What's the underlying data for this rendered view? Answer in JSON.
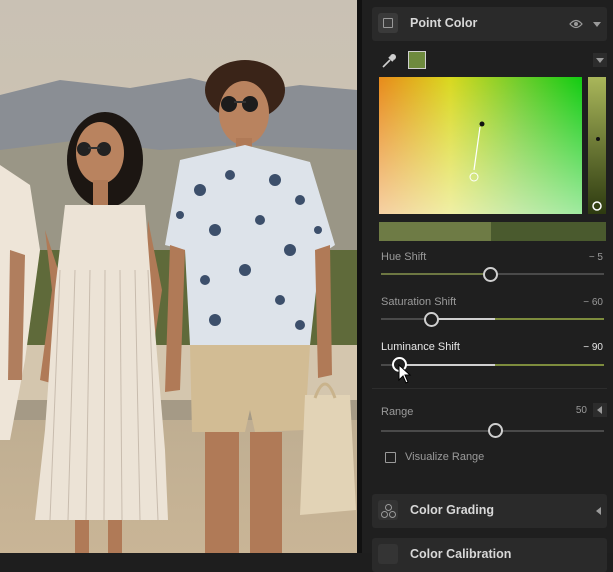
{
  "colors": {
    "panel_bg": "#1f1f1f",
    "header_bg": "#2a2a2a",
    "accent": "#7d8c3d",
    "swatch": "#6e8a3e"
  },
  "point_color": {
    "title": "Point Color",
    "section_icon": "point-color-icon",
    "visibility_icon": "eye-icon",
    "picker_icon": "eyedropper-icon",
    "sliders": [
      {
        "label": "Hue Shift",
        "value": "− 5",
        "level": 0.5,
        "active": false
      },
      {
        "label": "Saturation Shift",
        "value": "− 60",
        "level": 0.2,
        "active": false
      },
      {
        "label": "Luminance Shift",
        "value": "− 90",
        "level": 0.05,
        "active": true
      }
    ],
    "range": {
      "label": "Range",
      "value": "50",
      "level": 0.5
    },
    "visualize": {
      "label": "Visualize Range",
      "checked": false
    }
  },
  "color_grading": {
    "title": "Color Grading",
    "icon": "color-grading-icon"
  },
  "color_calibration": {
    "title": "Color Calibration",
    "icon": "color-calibration-icon"
  }
}
